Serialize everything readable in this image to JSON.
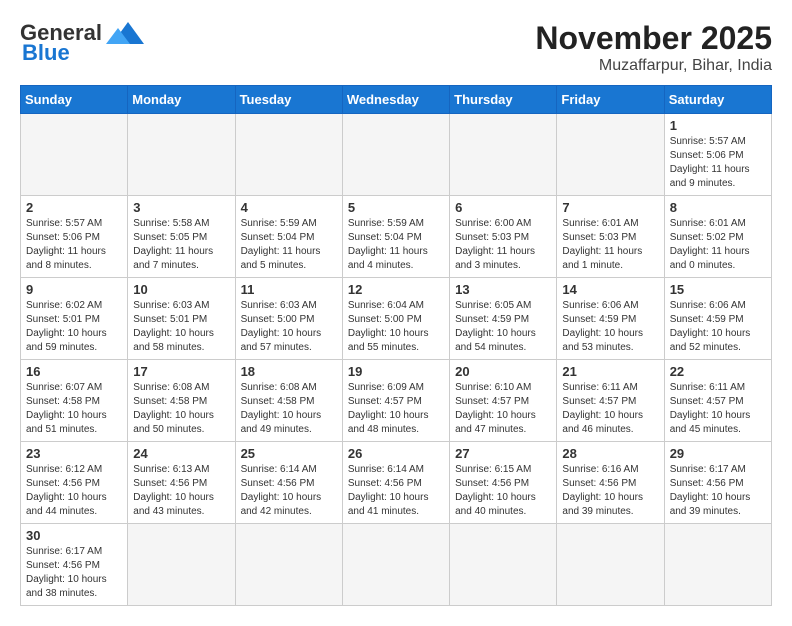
{
  "header": {
    "logo_general": "General",
    "logo_blue": "Blue",
    "month_year": "November 2025",
    "location": "Muzaffarpur, Bihar, India"
  },
  "weekdays": [
    "Sunday",
    "Monday",
    "Tuesday",
    "Wednesday",
    "Thursday",
    "Friday",
    "Saturday"
  ],
  "weeks": [
    [
      {
        "day": "",
        "info": ""
      },
      {
        "day": "",
        "info": ""
      },
      {
        "day": "",
        "info": ""
      },
      {
        "day": "",
        "info": ""
      },
      {
        "day": "",
        "info": ""
      },
      {
        "day": "",
        "info": ""
      },
      {
        "day": "1",
        "info": "Sunrise: 5:57 AM\nSunset: 5:06 PM\nDaylight: 11 hours\nand 9 minutes."
      }
    ],
    [
      {
        "day": "2",
        "info": "Sunrise: 5:57 AM\nSunset: 5:06 PM\nDaylight: 11 hours\nand 8 minutes."
      },
      {
        "day": "3",
        "info": "Sunrise: 5:58 AM\nSunset: 5:05 PM\nDaylight: 11 hours\nand 7 minutes."
      },
      {
        "day": "4",
        "info": "Sunrise: 5:59 AM\nSunset: 5:04 PM\nDaylight: 11 hours\nand 5 minutes."
      },
      {
        "day": "5",
        "info": "Sunrise: 5:59 AM\nSunset: 5:04 PM\nDaylight: 11 hours\nand 4 minutes."
      },
      {
        "day": "6",
        "info": "Sunrise: 6:00 AM\nSunset: 5:03 PM\nDaylight: 11 hours\nand 3 minutes."
      },
      {
        "day": "7",
        "info": "Sunrise: 6:01 AM\nSunset: 5:03 PM\nDaylight: 11 hours\nand 1 minute."
      },
      {
        "day": "8",
        "info": "Sunrise: 6:01 AM\nSunset: 5:02 PM\nDaylight: 11 hours\nand 0 minutes."
      }
    ],
    [
      {
        "day": "9",
        "info": "Sunrise: 6:02 AM\nSunset: 5:01 PM\nDaylight: 10 hours\nand 59 minutes."
      },
      {
        "day": "10",
        "info": "Sunrise: 6:03 AM\nSunset: 5:01 PM\nDaylight: 10 hours\nand 58 minutes."
      },
      {
        "day": "11",
        "info": "Sunrise: 6:03 AM\nSunset: 5:00 PM\nDaylight: 10 hours\nand 57 minutes."
      },
      {
        "day": "12",
        "info": "Sunrise: 6:04 AM\nSunset: 5:00 PM\nDaylight: 10 hours\nand 55 minutes."
      },
      {
        "day": "13",
        "info": "Sunrise: 6:05 AM\nSunset: 4:59 PM\nDaylight: 10 hours\nand 54 minutes."
      },
      {
        "day": "14",
        "info": "Sunrise: 6:06 AM\nSunset: 4:59 PM\nDaylight: 10 hours\nand 53 minutes."
      },
      {
        "day": "15",
        "info": "Sunrise: 6:06 AM\nSunset: 4:59 PM\nDaylight: 10 hours\nand 52 minutes."
      }
    ],
    [
      {
        "day": "16",
        "info": "Sunrise: 6:07 AM\nSunset: 4:58 PM\nDaylight: 10 hours\nand 51 minutes."
      },
      {
        "day": "17",
        "info": "Sunrise: 6:08 AM\nSunset: 4:58 PM\nDaylight: 10 hours\nand 50 minutes."
      },
      {
        "day": "18",
        "info": "Sunrise: 6:08 AM\nSunset: 4:58 PM\nDaylight: 10 hours\nand 49 minutes."
      },
      {
        "day": "19",
        "info": "Sunrise: 6:09 AM\nSunset: 4:57 PM\nDaylight: 10 hours\nand 48 minutes."
      },
      {
        "day": "20",
        "info": "Sunrise: 6:10 AM\nSunset: 4:57 PM\nDaylight: 10 hours\nand 47 minutes."
      },
      {
        "day": "21",
        "info": "Sunrise: 6:11 AM\nSunset: 4:57 PM\nDaylight: 10 hours\nand 46 minutes."
      },
      {
        "day": "22",
        "info": "Sunrise: 6:11 AM\nSunset: 4:57 PM\nDaylight: 10 hours\nand 45 minutes."
      }
    ],
    [
      {
        "day": "23",
        "info": "Sunrise: 6:12 AM\nSunset: 4:56 PM\nDaylight: 10 hours\nand 44 minutes."
      },
      {
        "day": "24",
        "info": "Sunrise: 6:13 AM\nSunset: 4:56 PM\nDaylight: 10 hours\nand 43 minutes."
      },
      {
        "day": "25",
        "info": "Sunrise: 6:14 AM\nSunset: 4:56 PM\nDaylight: 10 hours\nand 42 minutes."
      },
      {
        "day": "26",
        "info": "Sunrise: 6:14 AM\nSunset: 4:56 PM\nDaylight: 10 hours\nand 41 minutes."
      },
      {
        "day": "27",
        "info": "Sunrise: 6:15 AM\nSunset: 4:56 PM\nDaylight: 10 hours\nand 40 minutes."
      },
      {
        "day": "28",
        "info": "Sunrise: 6:16 AM\nSunset: 4:56 PM\nDaylight: 10 hours\nand 39 minutes."
      },
      {
        "day": "29",
        "info": "Sunrise: 6:17 AM\nSunset: 4:56 PM\nDaylight: 10 hours\nand 39 minutes."
      }
    ],
    [
      {
        "day": "30",
        "info": "Sunrise: 6:17 AM\nSunset: 4:56 PM\nDaylight: 10 hours\nand 38 minutes."
      },
      {
        "day": "",
        "info": ""
      },
      {
        "day": "",
        "info": ""
      },
      {
        "day": "",
        "info": ""
      },
      {
        "day": "",
        "info": ""
      },
      {
        "day": "",
        "info": ""
      },
      {
        "day": "",
        "info": ""
      }
    ]
  ]
}
